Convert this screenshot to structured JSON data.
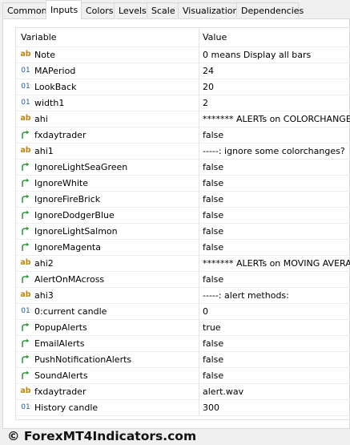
{
  "tabs": [
    {
      "label": "Common"
    },
    {
      "label": "Inputs",
      "active": true
    },
    {
      "label": "Colors"
    },
    {
      "label": "Levels"
    },
    {
      "label": "Scale"
    },
    {
      "label": "Visualization"
    },
    {
      "label": "Dependencies"
    }
  ],
  "grid": {
    "header": {
      "variable": "Variable",
      "value": "Value"
    },
    "rows": [
      {
        "type": "string",
        "icon": "ab",
        "name": "Note",
        "value": "0 means Display all bars"
      },
      {
        "type": "int",
        "icon": "01",
        "name": "MAPeriod",
        "value": "24"
      },
      {
        "type": "int",
        "icon": "01",
        "name": "LookBack",
        "value": "20"
      },
      {
        "type": "int",
        "icon": "01",
        "name": "width1",
        "value": "2"
      },
      {
        "type": "string",
        "icon": "ab",
        "name": "ahi",
        "value": "******* ALERTs on COLORCHANGE?"
      },
      {
        "type": "bool",
        "icon": "arrow",
        "name": "fxdaytrader",
        "value": "false"
      },
      {
        "type": "string",
        "icon": "ab",
        "name": "ahi1",
        "value": "-----: ignore some colorchanges?"
      },
      {
        "type": "bool",
        "icon": "arrow",
        "name": "IgnoreLightSeaGreen",
        "value": "false"
      },
      {
        "type": "bool",
        "icon": "arrow",
        "name": "IgnoreWhite",
        "value": "false"
      },
      {
        "type": "bool",
        "icon": "arrow",
        "name": "IgnoreFireBrick",
        "value": "false"
      },
      {
        "type": "bool",
        "icon": "arrow",
        "name": "IgnoreDodgerBlue",
        "value": "false"
      },
      {
        "type": "bool",
        "icon": "arrow",
        "name": "IgnoreLightSalmon",
        "value": "false"
      },
      {
        "type": "bool",
        "icon": "arrow",
        "name": "IgnoreMagenta",
        "value": "false"
      },
      {
        "type": "string",
        "icon": "ab",
        "name": "ahi2",
        "value": "******* ALERTs on MOVING AVERAGE"
      },
      {
        "type": "bool",
        "icon": "arrow",
        "name": "AlertOnMAcross",
        "value": "false"
      },
      {
        "type": "string",
        "icon": "ab",
        "name": "ahi3",
        "value": "-----: alert methods:"
      },
      {
        "type": "int",
        "icon": "01",
        "name": "0:current candle",
        "value": "0"
      },
      {
        "type": "bool",
        "icon": "arrow",
        "name": "PopupAlerts",
        "value": "true"
      },
      {
        "type": "bool",
        "icon": "arrow",
        "name": "EmailAlerts",
        "value": "false"
      },
      {
        "type": "bool",
        "icon": "arrow",
        "name": "PushNotificationAlerts",
        "value": "false"
      },
      {
        "type": "bool",
        "icon": "arrow",
        "name": "SoundAlerts",
        "value": "false"
      },
      {
        "type": "string",
        "icon": "ab",
        "name": "fxdaytrader",
        "value": "alert.wav"
      },
      {
        "type": "int",
        "icon": "01",
        "name": "History candle",
        "value": "300"
      }
    ]
  },
  "watermark": {
    "text": "© ForexMT4Indicators.com"
  },
  "colors": {
    "icon_ab": "#b8860b",
    "icon_int": "#1e5aa8",
    "icon_bool": "#2e9e3a"
  }
}
